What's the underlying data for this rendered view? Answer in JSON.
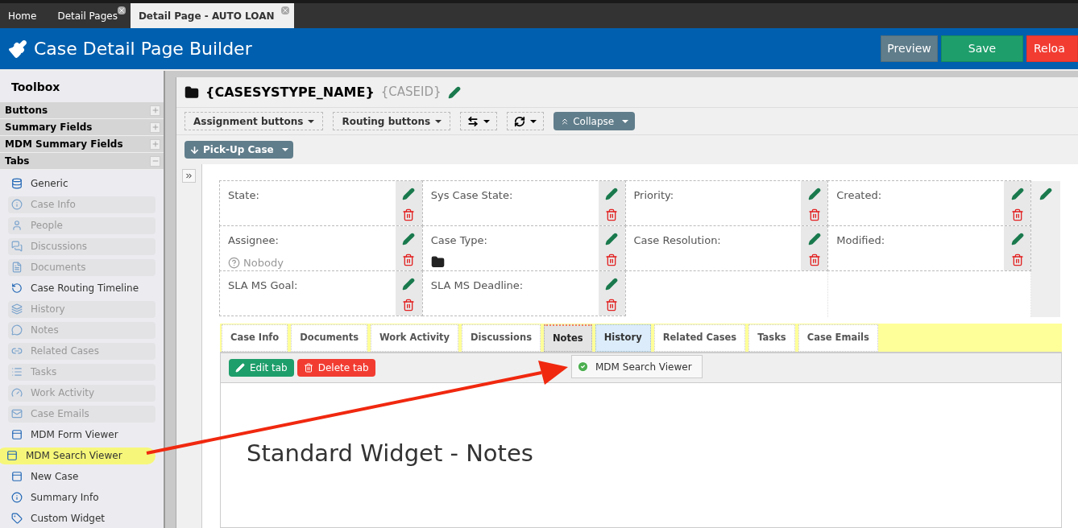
{
  "app_tabs": [
    {
      "label": "Home",
      "selected": false,
      "closable": false
    },
    {
      "label": "Detail Pages",
      "selected": false,
      "closable": true
    },
    {
      "label": "Detail Page - AUTO LOAN",
      "selected": true,
      "closable": true
    }
  ],
  "header": {
    "title": "Case Detail Page Builder",
    "buttons": [
      {
        "label": "Preview",
        "kind": "preview"
      },
      {
        "label": "Save",
        "kind": "save"
      },
      {
        "label": "Reloa",
        "kind": "reload"
      }
    ]
  },
  "toolbox": {
    "title": "Toolbox",
    "sections": [
      {
        "label": "Buttons",
        "expanded": false
      },
      {
        "label": "Summary Fields",
        "expanded": false
      },
      {
        "label": "MDM Summary Fields",
        "expanded": false
      },
      {
        "label": "Tabs",
        "expanded": true,
        "items": [
          {
            "label": "Generic",
            "disabled": false,
            "highlighted": false
          },
          {
            "label": "Case Info",
            "disabled": true,
            "highlighted": false
          },
          {
            "label": "People",
            "disabled": true,
            "highlighted": false
          },
          {
            "label": "Discussions",
            "disabled": true,
            "highlighted": false
          },
          {
            "label": "Documents",
            "disabled": true,
            "highlighted": false
          },
          {
            "label": "Case Routing Timeline",
            "disabled": false,
            "highlighted": false
          },
          {
            "label": "History",
            "disabled": true,
            "highlighted": false
          },
          {
            "label": "Notes",
            "disabled": true,
            "highlighted": false
          },
          {
            "label": "Related Cases",
            "disabled": true,
            "highlighted": false
          },
          {
            "label": "Tasks",
            "disabled": true,
            "highlighted": false
          },
          {
            "label": "Work Activity",
            "disabled": true,
            "highlighted": false
          },
          {
            "label": "Case Emails",
            "disabled": true,
            "highlighted": false
          },
          {
            "label": "MDM Form Viewer",
            "disabled": false,
            "highlighted": false
          },
          {
            "label": "MDM Search Viewer",
            "disabled": false,
            "highlighted": true
          },
          {
            "label": "New Case",
            "disabled": false,
            "highlighted": false
          },
          {
            "label": "Summary Info",
            "disabled": false,
            "highlighted": false
          },
          {
            "label": "Custom Widget",
            "disabled": false,
            "highlighted": false
          }
        ]
      }
    ]
  },
  "page": {
    "title": "{CASESYSTYPE_NAME}",
    "subtitle": "{CASEID}",
    "toolbar": [
      {
        "label": "Assignment buttons",
        "kind": "dropdown"
      },
      {
        "label": "Routing buttons",
        "kind": "dropdown"
      },
      {
        "kind": "resize"
      },
      {
        "kind": "refresh"
      },
      {
        "label": "Collapse",
        "kind": "collapse"
      }
    ],
    "action_button": "Pick-Up Case",
    "fields": [
      [
        {
          "kind": "field",
          "label": "State:"
        },
        {
          "kind": "field",
          "label": "Sys Case State:"
        },
        {
          "kind": "field",
          "label": "Priority:"
        },
        {
          "kind": "field",
          "label": "Created:"
        }
      ],
      [
        {
          "kind": "field",
          "label": "Assignee:",
          "value": "Nobody"
        },
        {
          "kind": "folder-field",
          "label": "Case Type:"
        },
        {
          "kind": "field",
          "label": "Case Resolution:"
        },
        {
          "kind": "field",
          "label": "Modified:"
        }
      ],
      [
        {
          "kind": "field",
          "label": "SLA MS Goal:"
        },
        {
          "kind": "field",
          "label": "SLA MS Deadline:"
        },
        {
          "kind": "empty"
        },
        {
          "kind": "empty"
        }
      ]
    ],
    "tabs": [
      {
        "label": "Case Info",
        "selected": false,
        "drop_target": false
      },
      {
        "label": "Documents",
        "selected": false,
        "drop_target": false
      },
      {
        "label": "Work Activity",
        "selected": false,
        "drop_target": false
      },
      {
        "label": "Discussions",
        "selected": false,
        "drop_target": false
      },
      {
        "label": "Notes",
        "selected": true,
        "drop_target": false
      },
      {
        "label": "History",
        "selected": false,
        "drop_target": true
      },
      {
        "label": "Related Cases",
        "selected": false,
        "drop_target": false
      },
      {
        "label": "Tasks",
        "selected": false,
        "drop_target": false
      },
      {
        "label": "Case Emails",
        "selected": false,
        "drop_target": false
      }
    ],
    "tab_actions": [
      {
        "label": "Edit tab",
        "kind": "edit"
      },
      {
        "label": "Delete tab",
        "kind": "delete"
      }
    ],
    "drag_item": "MDM Search Viewer",
    "widget_title": "Standard Widget - Notes"
  }
}
